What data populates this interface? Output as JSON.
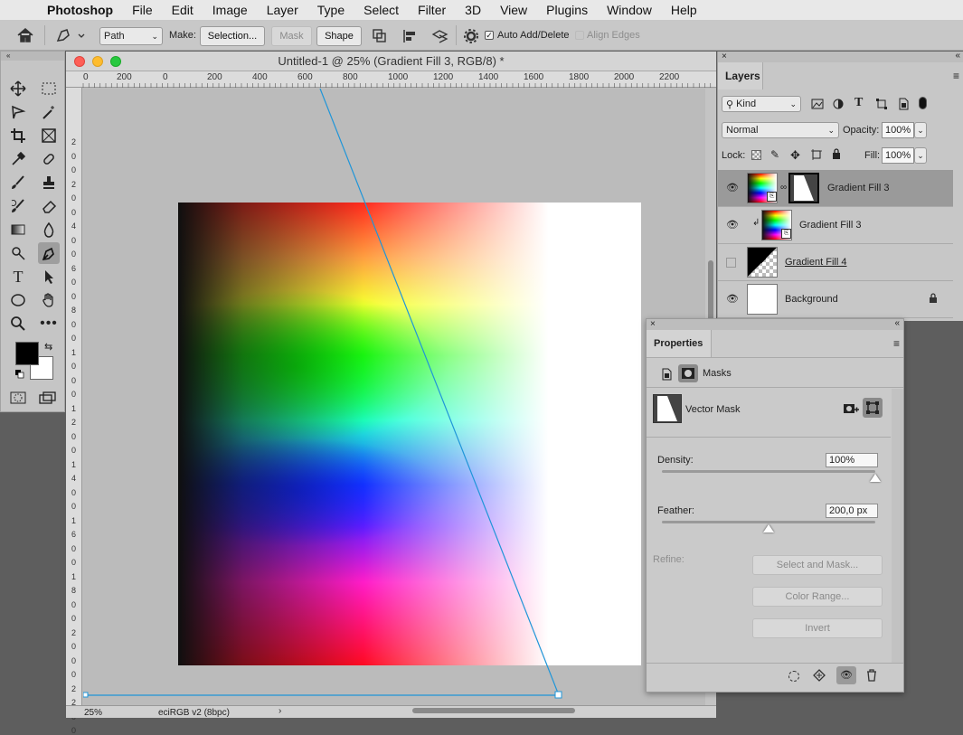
{
  "menubar": {
    "app": "Photoshop",
    "items": [
      "File",
      "Edit",
      "Image",
      "Layer",
      "Type",
      "Select",
      "Filter",
      "3D",
      "View",
      "Plugins",
      "Window",
      "Help"
    ]
  },
  "options": {
    "mode": "Path",
    "make_label": "Make:",
    "selection_btn": "Selection...",
    "mask_btn": "Mask",
    "shape_btn": "Shape",
    "auto_add_delete": "Auto Add/Delete",
    "align_edges": "Align Edges"
  },
  "document": {
    "title": "Untitled-1 @ 25% (Gradient Fill 3, RGB/8) *",
    "zoom": "25%",
    "profile": "eciRGB v2 (8bpc)",
    "ruler_h_ticks": [
      "0",
      "200",
      "0",
      "200",
      "400",
      "600",
      "800",
      "1000",
      "1200",
      "1400",
      "1600",
      "1800",
      "2000",
      "2200"
    ],
    "ruler_v_ticks": [
      "2",
      "0",
      "0",
      "2",
      "0",
      "0",
      "4",
      "0",
      "0",
      "6",
      "0",
      "0",
      "8",
      "0",
      "0",
      "1",
      "0",
      "0",
      "0",
      "1",
      "2",
      "0",
      "0",
      "1",
      "4",
      "0",
      "0",
      "1",
      "6",
      "0",
      "0",
      "1",
      "8",
      "0",
      "0",
      "2",
      "0",
      "0",
      "0",
      "2",
      "2",
      "0",
      "0"
    ]
  },
  "layers_panel": {
    "tab": "Layers",
    "filter_kind": "Kind",
    "blend_mode": "Normal",
    "opacity_label": "Opacity:",
    "opacity": "100%",
    "lock_label": "Lock:",
    "fill_label": "Fill:",
    "fill": "100%",
    "layers": [
      {
        "name": "Gradient Fill 3",
        "visible": true,
        "selected": true
      },
      {
        "name": "Gradient Fill 3",
        "visible": true,
        "selected": false
      },
      {
        "name": "Gradient Fill 4",
        "visible": false,
        "selected": false
      },
      {
        "name": "Background",
        "visible": true,
        "selected": false
      }
    ]
  },
  "properties_panel": {
    "tab": "Properties",
    "section": "Masks",
    "mask_type": "Vector Mask",
    "density_label": "Density:",
    "density": "100%",
    "density_level": 1.0,
    "feather_label": "Feather:",
    "feather": "200,0 px",
    "feather_level": 0.5,
    "refine_label": "Refine:",
    "select_and_mask": "Select and Mask...",
    "color_range": "Color Range...",
    "invert": "Invert"
  },
  "colors": {
    "path_line": "#1f95d8",
    "foreground": "#000000",
    "background": "#ffffff",
    "selected_layer": "#9a9a9a"
  }
}
